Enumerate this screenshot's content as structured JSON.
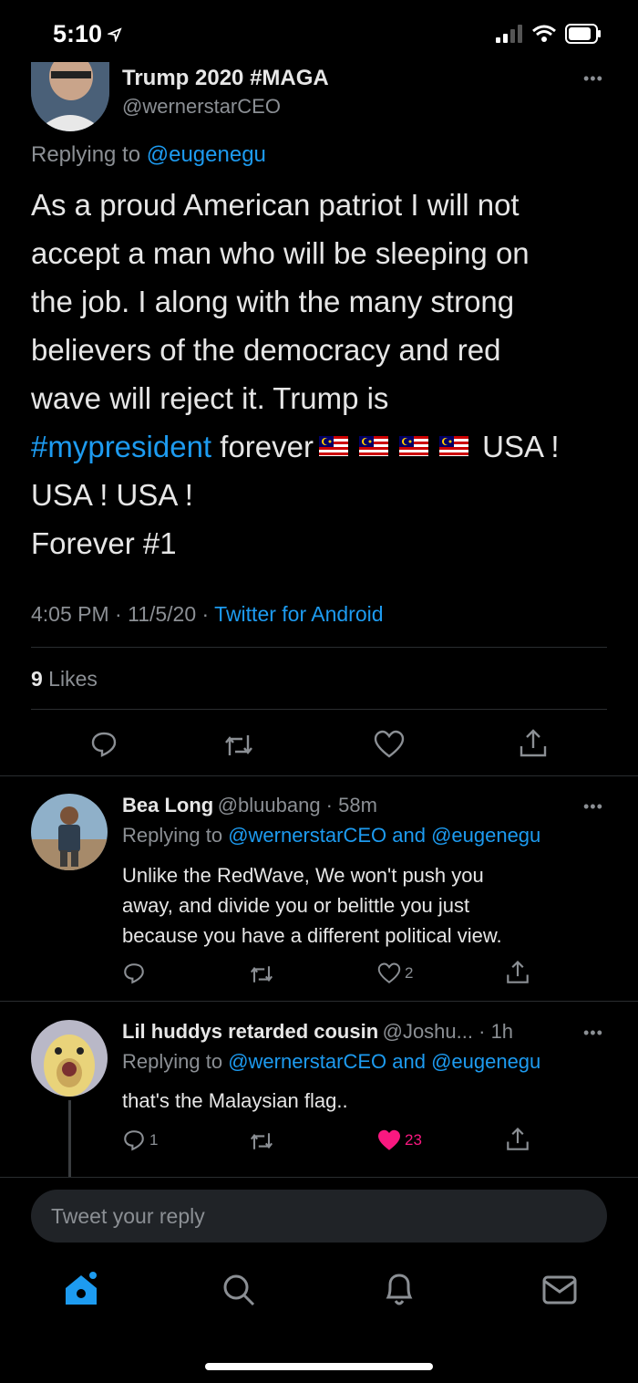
{
  "status_bar": {
    "time": "5:10"
  },
  "main_tweet": {
    "name": "Trump 2020 #MAGA",
    "handle": "@wernerstarCEO",
    "replying_prefix": "Replying to ",
    "replying_to": "@eugenegu",
    "text_part1": "As a proud American patriot I will not\naccept a man who will be sleeping on\nthe job. I along with the many strong\nbelievers of the democracy and red\nwave will reject it. Trump is\n",
    "hashtag": "#mypresident",
    "text_part2": " forever",
    "text_part3": " USA !\nUSA ! USA !\nForever #1",
    "time": "4:05 PM",
    "date": "11/5/20",
    "source": "Twitter for Android",
    "likes_count": "9",
    "likes_label": " Likes"
  },
  "replies": [
    {
      "name": "Bea Long",
      "handle": "@bluubang",
      "time": "58m",
      "replying_prefix": "Replying to ",
      "replying_to_1": "@wernerstarCEO",
      "replying_and": " and ",
      "replying_to_2": "@eugenegu",
      "text": "Unlike the RedWave, We won't push you\naway, and divide you or belittle you just\nbecause you have a different political view.",
      "reply_count": "",
      "retweet_count": "",
      "like_count": "2"
    },
    {
      "name": "Lil huddys retarded cousin",
      "handle": "@Joshu...",
      "time": "1h",
      "replying_prefix": "Replying to ",
      "replying_to_1": "@wernerstarCEO",
      "replying_and": " and ",
      "replying_to_2": "@eugenegu",
      "text": "that's the Malaysian flag..",
      "reply_count": "1",
      "retweet_count": "",
      "like_count": "23"
    }
  ],
  "compose": {
    "placeholder": "Tweet your reply"
  },
  "colors": {
    "accent": "#1d9bf0",
    "like": "#f91880",
    "muted": "#8b8f94",
    "background": "#000000"
  }
}
